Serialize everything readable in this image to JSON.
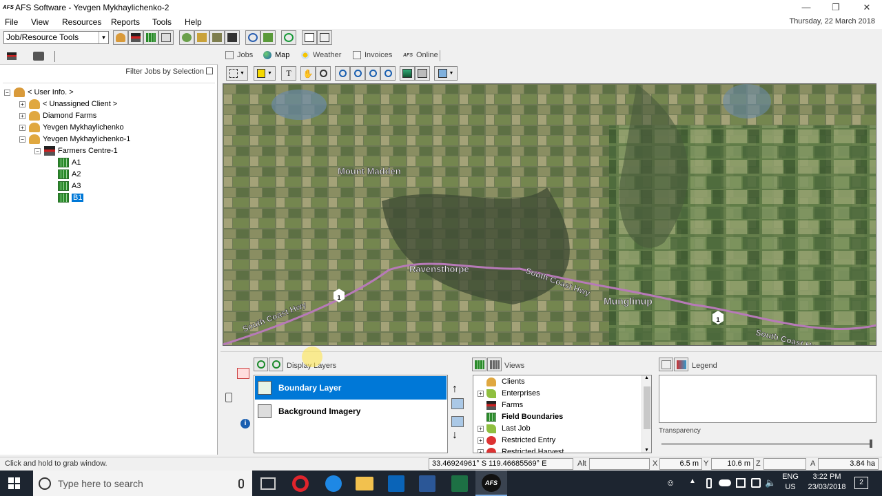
{
  "window": {
    "logo": "AFS",
    "title": "AFS Software - Yevgen Mykhaylichenko-2"
  },
  "menu": {
    "items": [
      "File",
      "View",
      "Resources",
      "Reports",
      "Tools",
      "Help"
    ],
    "date": "Thursday, 22 March 2018"
  },
  "toolbar": {
    "mode_select": "Job/Resource Tools"
  },
  "left": {
    "filter_label": "Filter Jobs by Selection",
    "tree": [
      {
        "label": "< User Info. >",
        "level": 0,
        "expander": "−",
        "icon": "user-icon"
      },
      {
        "label": "< Unassigned Client >",
        "level": 1,
        "expander": "+",
        "icon": "client-icon"
      },
      {
        "label": "Diamond Farms",
        "level": 1,
        "expander": "+",
        "icon": "client-icon"
      },
      {
        "label": "Yevgen Mykhaylichenko",
        "level": 1,
        "expander": "+",
        "icon": "client-icon"
      },
      {
        "label": "Yevgen Mykhaylichenko-1",
        "level": 1,
        "expander": "−",
        "icon": "client-icon"
      },
      {
        "label": "Farmers Centre-1",
        "level": 2,
        "expander": "−",
        "icon": "farm-icon"
      },
      {
        "label": "A1",
        "level": 3,
        "icon": "field-icon"
      },
      {
        "label": "A2",
        "level": 3,
        "icon": "field-icon"
      },
      {
        "label": "A3",
        "level": 3,
        "icon": "field-icon"
      },
      {
        "label": "B1",
        "level": 3,
        "icon": "field-icon",
        "selected": true
      }
    ]
  },
  "tabs": [
    {
      "label": "Jobs",
      "icon": "jobs-icon"
    },
    {
      "label": "Map",
      "icon": "globe-icon",
      "active": true
    },
    {
      "label": "Weather",
      "icon": "weather-icon"
    },
    {
      "label": "Invoices",
      "icon": "invoice-icon"
    },
    {
      "label": "Online",
      "prefix": "AFS",
      "icon": "afs-online-icon"
    }
  ],
  "map": {
    "places": [
      "Mount Madden",
      "Ravensthorpe",
      "Munglinup"
    ],
    "roads": [
      "South Coast Hwy",
      "South Coast Hwy",
      "South Coast Hwy"
    ],
    "shields": [
      "1",
      "1"
    ]
  },
  "layers": {
    "title": "Display Layers",
    "items": [
      {
        "label": "Boundary Layer",
        "selected": true
      },
      {
        "label": "Background Imagery",
        "selected": false
      }
    ]
  },
  "views": {
    "title": "Views",
    "items": [
      {
        "label": "Clients",
        "expander": "",
        "icon": "client-icon"
      },
      {
        "label": "Enterprises",
        "expander": "+",
        "icon": "enterprise-icon"
      },
      {
        "label": "Farms",
        "expander": "",
        "icon": "farm-icon"
      },
      {
        "label": "Field Boundaries",
        "expander": "",
        "icon": "field-icon",
        "bold": true
      },
      {
        "label": "Last Job",
        "expander": "+",
        "icon": "enterprise-icon"
      },
      {
        "label": "Restricted Entry",
        "expander": "+",
        "icon": "restricted-icon"
      },
      {
        "label": "Restricted Harvest",
        "expander": "+",
        "icon": "restricted-icon"
      }
    ]
  },
  "legend": {
    "title": "Legend",
    "transparency_label": "Transparency"
  },
  "status": {
    "hint": "Click and hold to grab window.",
    "coords": "33.46924961° S   119.46685569° E",
    "alt_label": "Alt",
    "x_label": "X",
    "x_value": "6.5 m",
    "y_label": "Y",
    "y_value": "10.6 m",
    "z_label": "Z",
    "a_label": "A",
    "a_value": "3.84 ha"
  },
  "taskbar": {
    "search_placeholder": "Type here to search",
    "lang": "ENG",
    "region": "US",
    "time": "3:22 PM",
    "date": "23/03/2018",
    "notifications": "2",
    "apps": [
      "task-view-icon",
      "opera-icon",
      "edge-icon",
      "file-explorer-icon",
      "outlook-icon",
      "word-icon",
      "excel-icon",
      "afs-icon"
    ]
  },
  "colors": {
    "accent": "#0078d7",
    "taskbar": "#1d2530",
    "road": "#b77ab8"
  }
}
